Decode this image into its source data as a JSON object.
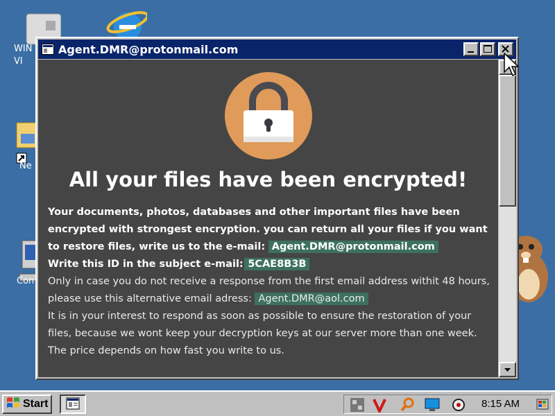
{
  "desktop": {
    "icons": [
      {
        "label": "WIN\nVI"
      },
      {
        "label": "Ne"
      },
      {
        "label": "Con"
      }
    ]
  },
  "window": {
    "title": "Agent.DMR@protonmail.com"
  },
  "ransom": {
    "headline": "All your files have been encrypted!",
    "para1": "Your documents, photos, databases and other important files have been encrypted with strongest encryption. you can return all your files if you want to restore files, write us to the e-mail:",
    "email_primary": "Agent.DMR@protonmail.com",
    "id_label": "Write this ID in the subject e-mail:",
    "id_value": "5CAE8B3B",
    "para2": "Only in case you do not receive a response from the first email address withit 48 hours, please use this alternative email adress:",
    "email_alt": "Agent.DMR@aol.com",
    "para3": "It is in your interest to respond as soon as possible to ensure the restoration of your files, because we wont keep your decryption keys at our server more than one week. The price depends on how fast you write to us."
  },
  "taskbar": {
    "start_label": "Start",
    "clock": "8:15 AM"
  },
  "colors": {
    "desktop": "#3a6ea5",
    "lock_circle": "#e09a5a",
    "content_bg": "#454545",
    "highlight": "#3d7060",
    "titlebar": "#0a246a"
  }
}
